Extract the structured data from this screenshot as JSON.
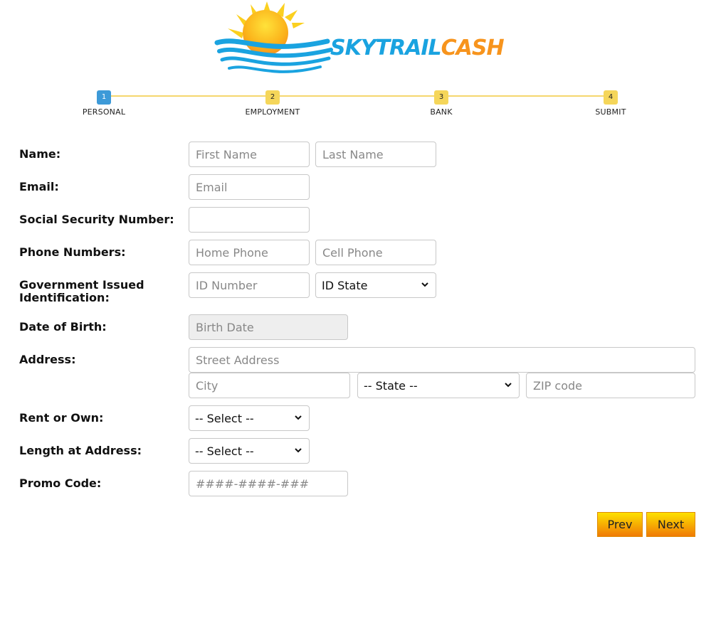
{
  "brand": {
    "part1": "SKYTRAIL",
    "part2": "CASH",
    "color_primary": "#1aa3e0",
    "color_accent": "#f7941d"
  },
  "stepper": {
    "steps": [
      {
        "num": "1",
        "label": "PERSONAL",
        "active": true
      },
      {
        "num": "2",
        "label": "EMPLOYMENT",
        "active": false
      },
      {
        "num": "3",
        "label": "BANK",
        "active": false
      },
      {
        "num": "4",
        "label": "SUBMIT",
        "active": false
      }
    ]
  },
  "form": {
    "name": {
      "label": "Name:",
      "first_placeholder": "First Name",
      "last_placeholder": "Last Name"
    },
    "email": {
      "label": "Email:",
      "placeholder": "Email"
    },
    "ssn": {
      "label": "Social Security Number:",
      "placeholder": ""
    },
    "phone": {
      "label": "Phone Numbers:",
      "home_placeholder": "Home Phone",
      "cell_placeholder": "Cell Phone"
    },
    "gov_id": {
      "label_line1": "Government Issued",
      "label_line2": "Identification:",
      "number_placeholder": "ID Number",
      "state_selected": "ID State"
    },
    "dob": {
      "label": "Date of Birth:",
      "placeholder": "Birth Date"
    },
    "address": {
      "label": "Address:",
      "street_placeholder": "Street Address",
      "city_placeholder": "City",
      "state_selected": "-- State --",
      "zip_placeholder": "ZIP code"
    },
    "rent_own": {
      "label": "Rent or Own:",
      "selected": "-- Select --"
    },
    "length_at_address": {
      "label": "Length at Address:",
      "selected": "-- Select --"
    },
    "promo": {
      "label": "Promo Code:",
      "placeholder": "####-####-###"
    }
  },
  "buttons": {
    "prev": "Prev",
    "next": "Next"
  },
  "colors": {
    "step_active": "#3d9ad8",
    "step_inactive": "#f5d65a",
    "button_top": "#fde100",
    "button_bottom": "#f07a05"
  }
}
